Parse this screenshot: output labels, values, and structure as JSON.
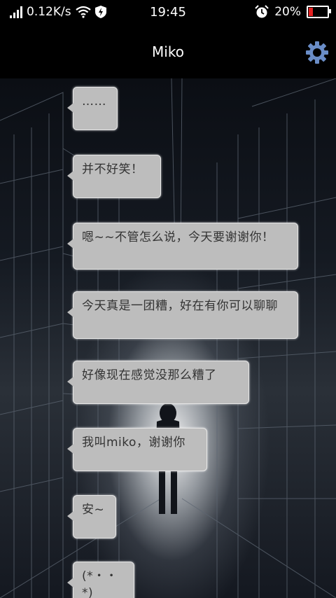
{
  "status_bar": {
    "network_speed": "0.12K/s",
    "time": "19:45",
    "battery_percent": "20%",
    "battery_level": 0.2
  },
  "header": {
    "title": "Miko"
  },
  "messages": [
    "……",
    "并不好笑！",
    "嗯~~不管怎么说，今天要谢谢你！",
    "今天真是一团糟，好在有你可以聊聊",
    "好像现在感觉没那么糟了",
    "我叫miko，谢谢你",
    "安~",
    "(*・・*)"
  ],
  "colors": {
    "bubble_bg": "#bdbdbd",
    "gear": "#6a8dc7",
    "battery_low": "#e52222"
  }
}
